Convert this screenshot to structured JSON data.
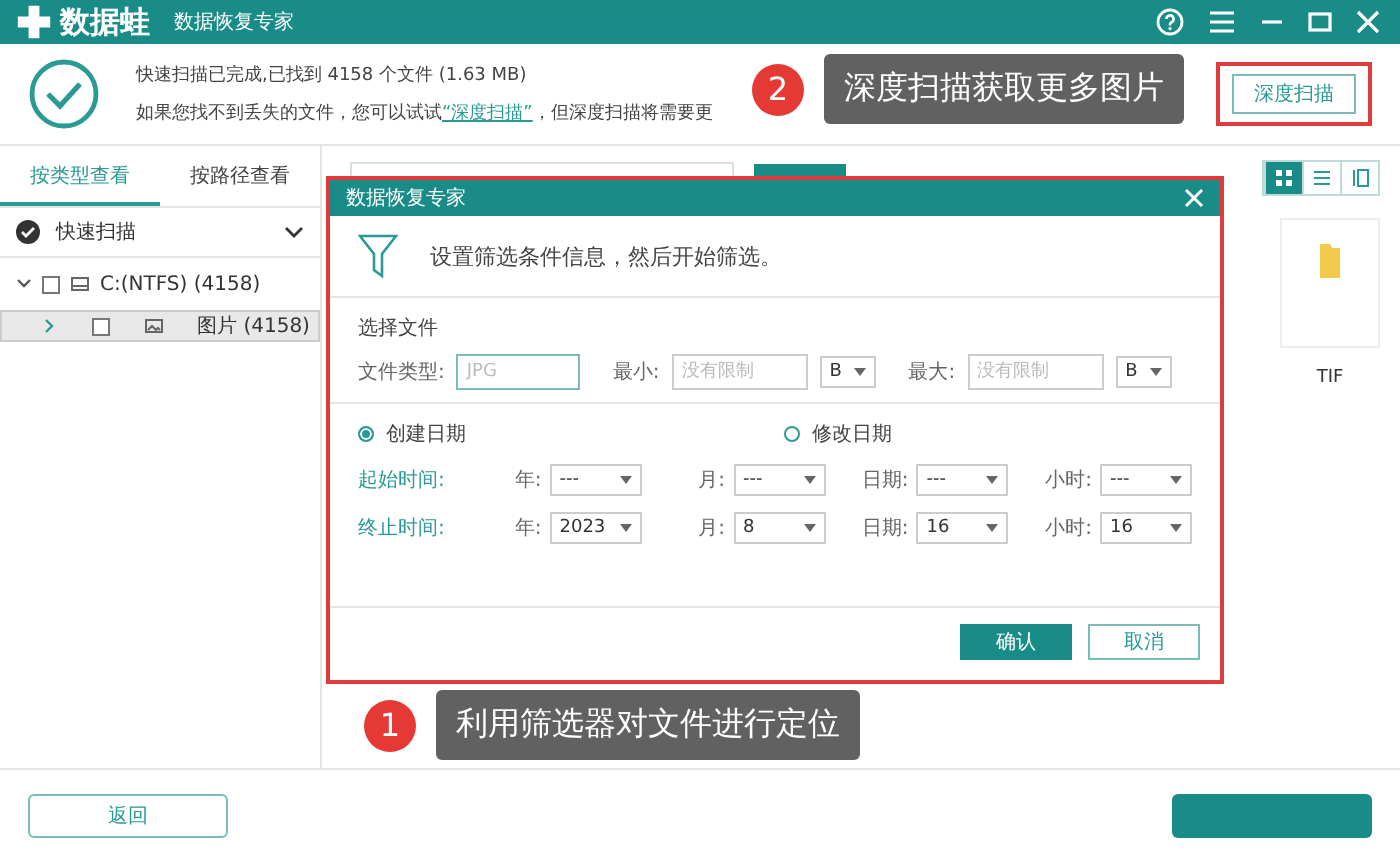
{
  "app": {
    "logo": "数据蛙",
    "subtitle": "数据恢复专家"
  },
  "header": {
    "status": "快速扫描已完成,已找到 4158 个文件 (1.63 MB)",
    "hint_before": "如果您找不到丢失的文件，您可以试试",
    "hint_link": "“深度扫描”",
    "hint_after": "，但深度扫描将需要更",
    "deep_scan_button": "深度扫描"
  },
  "callouts": [
    {
      "number": "2",
      "text": "深度扫描获取更多图片"
    },
    {
      "number": "1",
      "text": "利用筛选器对文件进行定位"
    }
  ],
  "tabs": [
    {
      "label": "按类型查看",
      "selected": true
    },
    {
      "label": "按路径查看",
      "selected": false
    }
  ],
  "tree": {
    "scan": "快速扫描",
    "expanded": true,
    "children": [
      {
        "label": "C:(NTFS) (4158)",
        "kind": "drive",
        "expanded": true,
        "checked": false,
        "selected": false,
        "children": [
          {
            "label": "图片 (4158)",
            "kind": "folder",
            "expanded": false,
            "checked": false,
            "selected": true
          }
        ]
      }
    ]
  },
  "view_modes": [
    {
      "kind": "grid",
      "selected": true
    },
    {
      "kind": "list",
      "selected": false
    },
    {
      "kind": "detail",
      "selected": false
    }
  ],
  "files": [
    {
      "name": "TIF"
    }
  ],
  "dialog": {
    "title": "数据恢复专家",
    "heading": "设置筛选条件信息，然后开始筛选。",
    "section": "选择文件",
    "filters": [
      {
        "kind": "text",
        "label": "文件类型:",
        "placeholder": "JPG"
      },
      {
        "kind": "size",
        "label": "最小:",
        "placeholder": "没有限制",
        "unit": "B"
      },
      {
        "kind": "size",
        "label": "最大:",
        "placeholder": "没有限制",
        "unit": "B"
      }
    ],
    "date_modes": [
      {
        "label": "创建日期",
        "selected": true
      },
      {
        "label": "修改日期",
        "selected": false
      }
    ],
    "time_rows": [
      {
        "label": "起始时间:",
        "fields": [
          {
            "label": "年:",
            "value": "---"
          },
          {
            "label": "月:",
            "value": "---"
          },
          {
            "label": "日期:",
            "value": "---"
          },
          {
            "label": "小时:",
            "value": "---"
          }
        ]
      },
      {
        "label": "终止时间:",
        "fields": [
          {
            "label": "年:",
            "value": "2023"
          },
          {
            "label": "月:",
            "value": "8"
          },
          {
            "label": "日期:",
            "value": "16"
          },
          {
            "label": "小时:",
            "value": "16"
          }
        ]
      }
    ],
    "confirm": "确认",
    "cancel": "取消"
  },
  "footer": {
    "back": "返回"
  }
}
